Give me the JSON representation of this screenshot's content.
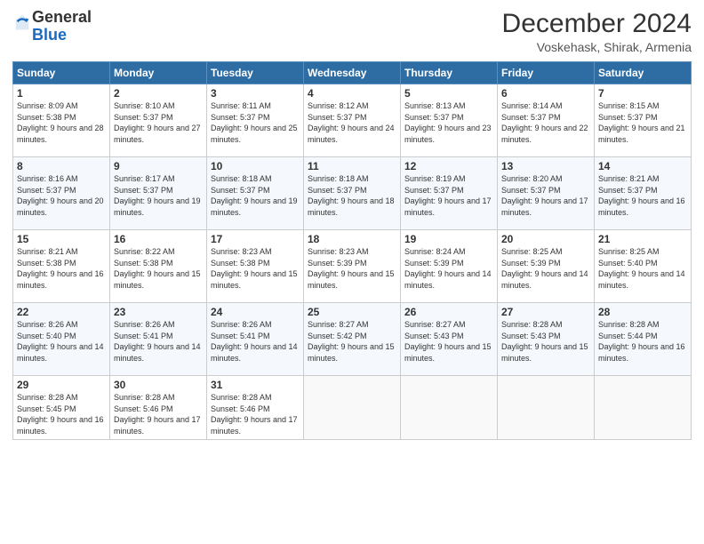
{
  "header": {
    "logo_general": "General",
    "logo_blue": "Blue",
    "month": "December 2024",
    "location": "Voskehask, Shirak, Armenia"
  },
  "days_of_week": [
    "Sunday",
    "Monday",
    "Tuesday",
    "Wednesday",
    "Thursday",
    "Friday",
    "Saturday"
  ],
  "weeks": [
    [
      {
        "day": "1",
        "sunrise": "8:09 AM",
        "sunset": "5:38 PM",
        "daylight": "9 hours and 28 minutes."
      },
      {
        "day": "2",
        "sunrise": "8:10 AM",
        "sunset": "5:37 PM",
        "daylight": "9 hours and 27 minutes."
      },
      {
        "day": "3",
        "sunrise": "8:11 AM",
        "sunset": "5:37 PM",
        "daylight": "9 hours and 25 minutes."
      },
      {
        "day": "4",
        "sunrise": "8:12 AM",
        "sunset": "5:37 PM",
        "daylight": "9 hours and 24 minutes."
      },
      {
        "day": "5",
        "sunrise": "8:13 AM",
        "sunset": "5:37 PM",
        "daylight": "9 hours and 23 minutes."
      },
      {
        "day": "6",
        "sunrise": "8:14 AM",
        "sunset": "5:37 PM",
        "daylight": "9 hours and 22 minutes."
      },
      {
        "day": "7",
        "sunrise": "8:15 AM",
        "sunset": "5:37 PM",
        "daylight": "9 hours and 21 minutes."
      }
    ],
    [
      {
        "day": "8",
        "sunrise": "8:16 AM",
        "sunset": "5:37 PM",
        "daylight": "9 hours and 20 minutes."
      },
      {
        "day": "9",
        "sunrise": "8:17 AM",
        "sunset": "5:37 PM",
        "daylight": "9 hours and 19 minutes."
      },
      {
        "day": "10",
        "sunrise": "8:18 AM",
        "sunset": "5:37 PM",
        "daylight": "9 hours and 19 minutes."
      },
      {
        "day": "11",
        "sunrise": "8:18 AM",
        "sunset": "5:37 PM",
        "daylight": "9 hours and 18 minutes."
      },
      {
        "day": "12",
        "sunrise": "8:19 AM",
        "sunset": "5:37 PM",
        "daylight": "9 hours and 17 minutes."
      },
      {
        "day": "13",
        "sunrise": "8:20 AM",
        "sunset": "5:37 PM",
        "daylight": "9 hours and 17 minutes."
      },
      {
        "day": "14",
        "sunrise": "8:21 AM",
        "sunset": "5:37 PM",
        "daylight": "9 hours and 16 minutes."
      }
    ],
    [
      {
        "day": "15",
        "sunrise": "8:21 AM",
        "sunset": "5:38 PM",
        "daylight": "9 hours and 16 minutes."
      },
      {
        "day": "16",
        "sunrise": "8:22 AM",
        "sunset": "5:38 PM",
        "daylight": "9 hours and 15 minutes."
      },
      {
        "day": "17",
        "sunrise": "8:23 AM",
        "sunset": "5:38 PM",
        "daylight": "9 hours and 15 minutes."
      },
      {
        "day": "18",
        "sunrise": "8:23 AM",
        "sunset": "5:39 PM",
        "daylight": "9 hours and 15 minutes."
      },
      {
        "day": "19",
        "sunrise": "8:24 AM",
        "sunset": "5:39 PM",
        "daylight": "9 hours and 14 minutes."
      },
      {
        "day": "20",
        "sunrise": "8:25 AM",
        "sunset": "5:39 PM",
        "daylight": "9 hours and 14 minutes."
      },
      {
        "day": "21",
        "sunrise": "8:25 AM",
        "sunset": "5:40 PM",
        "daylight": "9 hours and 14 minutes."
      }
    ],
    [
      {
        "day": "22",
        "sunrise": "8:26 AM",
        "sunset": "5:40 PM",
        "daylight": "9 hours and 14 minutes."
      },
      {
        "day": "23",
        "sunrise": "8:26 AM",
        "sunset": "5:41 PM",
        "daylight": "9 hours and 14 minutes."
      },
      {
        "day": "24",
        "sunrise": "8:26 AM",
        "sunset": "5:41 PM",
        "daylight": "9 hours and 14 minutes."
      },
      {
        "day": "25",
        "sunrise": "8:27 AM",
        "sunset": "5:42 PM",
        "daylight": "9 hours and 15 minutes."
      },
      {
        "day": "26",
        "sunrise": "8:27 AM",
        "sunset": "5:43 PM",
        "daylight": "9 hours and 15 minutes."
      },
      {
        "day": "27",
        "sunrise": "8:28 AM",
        "sunset": "5:43 PM",
        "daylight": "9 hours and 15 minutes."
      },
      {
        "day": "28",
        "sunrise": "8:28 AM",
        "sunset": "5:44 PM",
        "daylight": "9 hours and 16 minutes."
      }
    ],
    [
      {
        "day": "29",
        "sunrise": "8:28 AM",
        "sunset": "5:45 PM",
        "daylight": "9 hours and 16 minutes."
      },
      {
        "day": "30",
        "sunrise": "8:28 AM",
        "sunset": "5:46 PM",
        "daylight": "9 hours and 17 minutes."
      },
      {
        "day": "31",
        "sunrise": "8:28 AM",
        "sunset": "5:46 PM",
        "daylight": "9 hours and 17 minutes."
      },
      null,
      null,
      null,
      null
    ]
  ]
}
